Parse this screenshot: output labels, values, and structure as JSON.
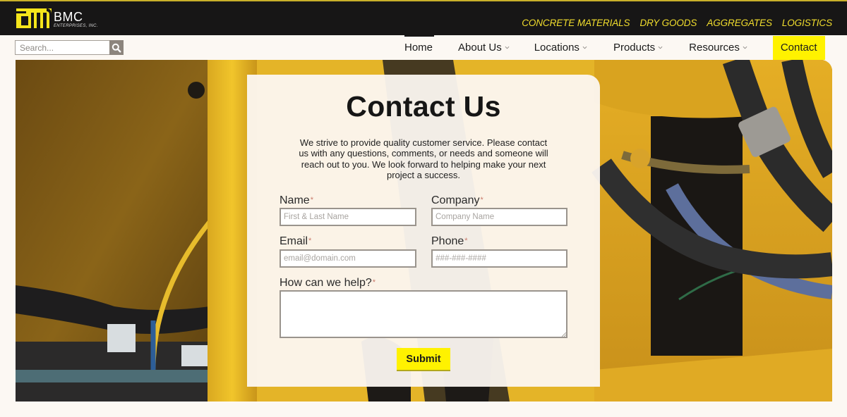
{
  "brand": {
    "name": "BMC",
    "subtitle": "ENTERPRISES, INC."
  },
  "divisions": [
    "CONCRETE MATERIALS",
    "DRY GOODS",
    "AGGREGATES",
    "LOGISTICS"
  ],
  "search": {
    "placeholder": "Search...",
    "icon": "search-icon"
  },
  "nav": {
    "items": [
      {
        "label": "Home",
        "has_dropdown": false,
        "active": true
      },
      {
        "label": "About Us",
        "has_dropdown": true
      },
      {
        "label": "Locations",
        "has_dropdown": true
      },
      {
        "label": "Products",
        "has_dropdown": true
      },
      {
        "label": "Resources",
        "has_dropdown": true
      }
    ],
    "contact_label": "Contact"
  },
  "colors": {
    "accent_yellow": "#fff200",
    "division_yellow": "#f2de2d",
    "topbar_bg": "#171616",
    "required_marker": "#c87a6b"
  },
  "contact": {
    "title": "Contact Us",
    "intro": "We strive to provide quality customer service. Please contact us with any questions, comments, or needs and someone will reach out to you. We look forward to helping make your next project a success.",
    "required_marker": "*",
    "fields": {
      "name": {
        "label": "Name",
        "placeholder": "First & Last Name",
        "value": ""
      },
      "company": {
        "label": "Company",
        "placeholder": "Company Name",
        "value": ""
      },
      "email": {
        "label": "Email",
        "placeholder": "email@domain.com",
        "value": ""
      },
      "phone": {
        "label": "Phone",
        "placeholder": "###-###-####",
        "value": ""
      },
      "message": {
        "label": "How can we help?",
        "placeholder": "",
        "value": ""
      }
    },
    "submit_label": "Submit"
  }
}
